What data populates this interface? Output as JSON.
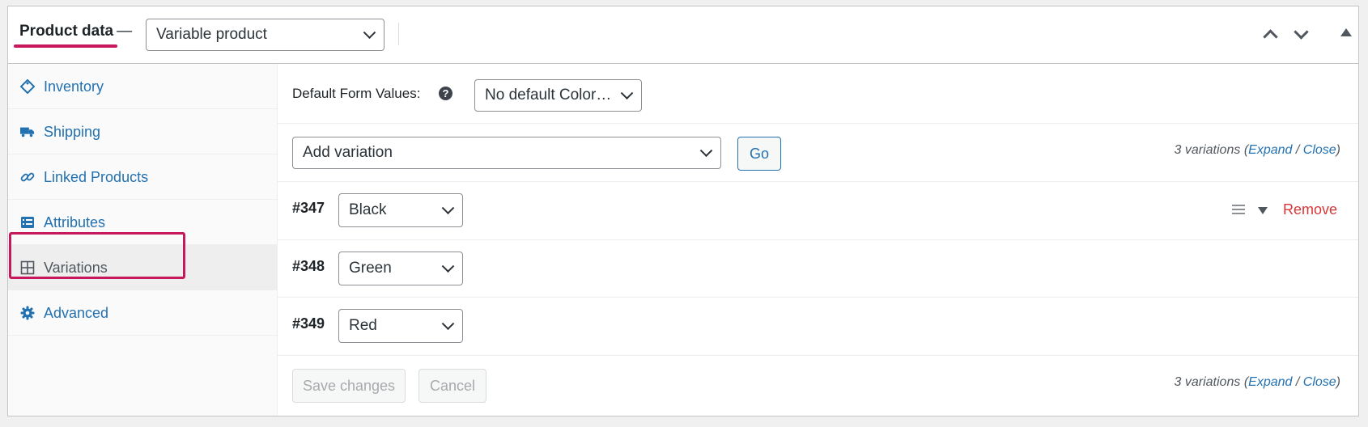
{
  "header": {
    "title": "Product data",
    "dash": "—",
    "product_type": "Variable product"
  },
  "sidebar": {
    "items": [
      {
        "label": "Inventory",
        "icon": "tag-icon"
      },
      {
        "label": "Shipping",
        "icon": "truck-icon"
      },
      {
        "label": "Linked Products",
        "icon": "link-icon"
      },
      {
        "label": "Attributes",
        "icon": "list-icon"
      },
      {
        "label": "Variations",
        "icon": "grid-icon",
        "active": true
      },
      {
        "label": "Advanced",
        "icon": "gear-icon"
      }
    ]
  },
  "main": {
    "default_form_values": {
      "label": "Default Form Values:",
      "help": "?",
      "selected": "No default Color…"
    },
    "add_variation": {
      "selected": "Add variation",
      "go_label": "Go"
    },
    "variation_count": {
      "count_text": "3 variations",
      "open_paren": "(",
      "expand": "Expand",
      "slash": "/",
      "close": "Close",
      "close_paren": ")"
    },
    "variations": [
      {
        "number": "#347",
        "value": "Black",
        "remove_label": "Remove"
      },
      {
        "number": "#348",
        "value": "Green"
      },
      {
        "number": "#349",
        "value": "Red"
      }
    ],
    "footer": {
      "save_label": "Save changes",
      "cancel_label": "Cancel"
    }
  },
  "colors": {
    "accent": "#2271b1",
    "highlight": "#c6185a",
    "remove": "#d63638"
  }
}
